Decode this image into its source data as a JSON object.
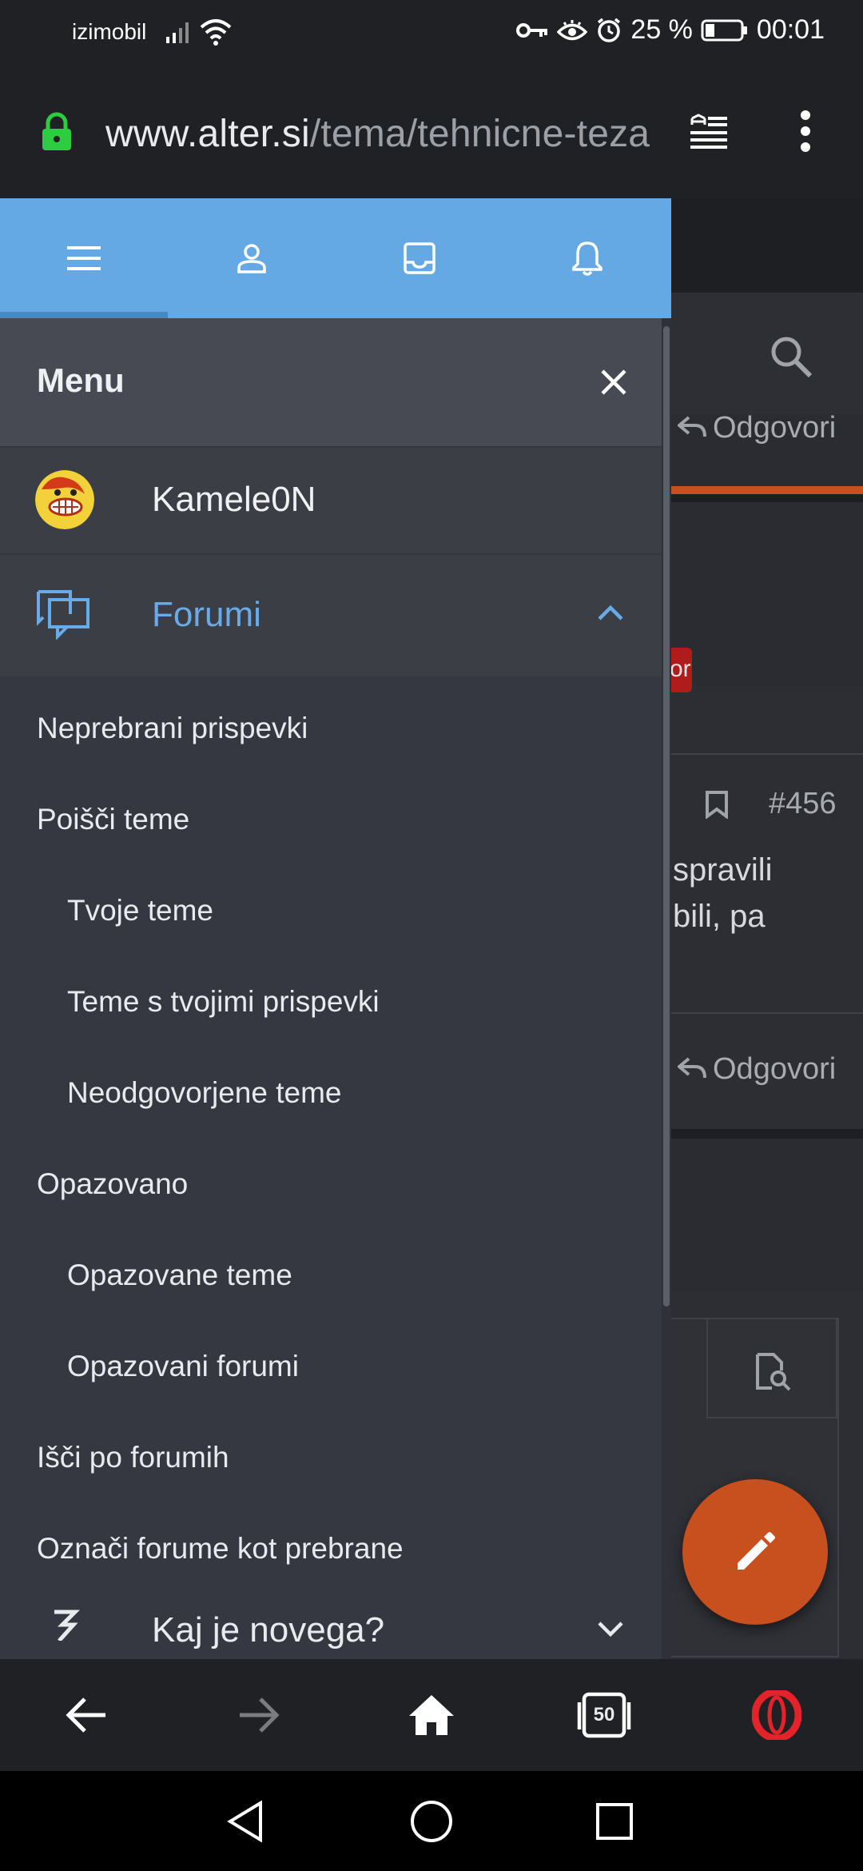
{
  "status_bar": {
    "carrier": "izimobil",
    "battery": "25 %",
    "time": "00:01"
  },
  "browser": {
    "url_domain": "www.alter.si",
    "url_path": "/tema/tehnicne-teza"
  },
  "drawer": {
    "tabs": [
      "menu-icon",
      "profile-icon",
      "inbox-icon",
      "bell-icon"
    ],
    "title": "Menu",
    "user": {
      "name": "Kamele0N"
    },
    "forums_label": "Forumi",
    "items": [
      {
        "label": "Neprebrani prispevki"
      },
      {
        "label": "Poišči teme"
      },
      {
        "label": "Tvoje teme"
      },
      {
        "label": "Teme s tvojimi prispevki"
      },
      {
        "label": "Neodgovorjene teme"
      },
      {
        "label": "Opazovano"
      },
      {
        "label": "Opazovane teme"
      },
      {
        "label": "Opazovani forumi"
      },
      {
        "label": "Išči po forumih"
      },
      {
        "label": "Označi forume kot prebrane"
      },
      {
        "label": "Kaj je novega?"
      }
    ]
  },
  "background_page": {
    "reply_label_1": "Odgovori",
    "reply_label_2": "Odgovori",
    "post_number": "#456",
    "badge_fragment": "or",
    "snippet_line_1": "spravili",
    "snippet_line_2": "bili, pa"
  },
  "bottom_nav": {
    "tabs_count": "50"
  },
  "colors": {
    "accent_blue": "#64a8e4",
    "forums_blue": "#69abe8",
    "fab_orange": "#c8501e",
    "drawer_bg": "#353840",
    "opera_red": "#e3222a"
  }
}
